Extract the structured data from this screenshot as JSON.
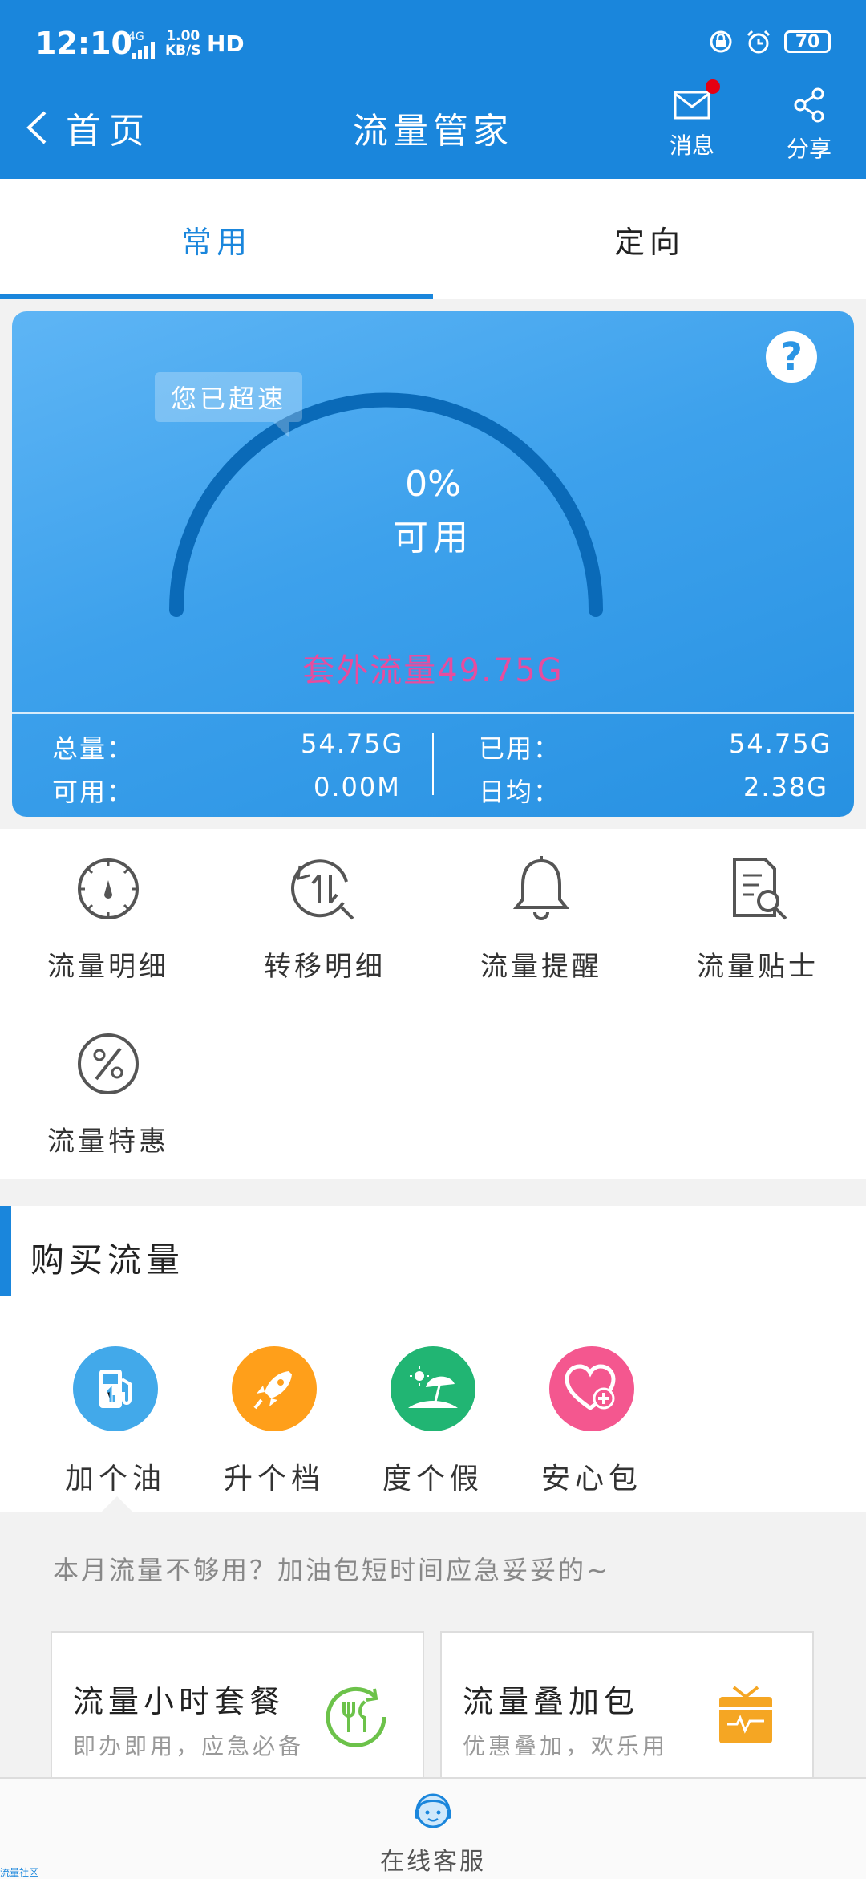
{
  "status_bar": {
    "time": "12:10",
    "network": "4G",
    "speed_value": "1.00",
    "speed_unit": "KB/S",
    "hd": "HD",
    "battery": "70",
    "icons": [
      "lock-rotation-icon",
      "alarm-icon"
    ]
  },
  "header": {
    "back_label": "首页",
    "title": "流量管家",
    "message_label": "消息",
    "share_label": "分享",
    "accent": "#1a86dc",
    "badge_color": "#e60012"
  },
  "tabs": [
    {
      "label": "常用",
      "active": true
    },
    {
      "label": "定向",
      "active": false
    }
  ],
  "usage": {
    "help": "?",
    "bubble": "您已超速",
    "percent": "0%",
    "percent_value": 0,
    "available_label": "可用",
    "overage": "套外流量49.75G",
    "stats": {
      "total_label": "总量：",
      "total_value": "54.75G",
      "available_label": "可用：",
      "available_value": "0.00M",
      "used_label": "已用：",
      "used_value": "54.75G",
      "daily_label": "日均：",
      "daily_value": "2.38G"
    }
  },
  "menu": [
    {
      "label": "流量明细",
      "icon": "dial-icon"
    },
    {
      "label": "转移明细",
      "icon": "transfer-search-icon"
    },
    {
      "label": "流量提醒",
      "icon": "bell-icon"
    },
    {
      "label": "流量贴士",
      "icon": "document-search-icon"
    },
    {
      "label": "流量特惠",
      "icon": "percent-icon"
    }
  ],
  "buy": {
    "title": "购买流量",
    "items": [
      {
        "label": "加个油",
        "icon": "fuel-pump-icon",
        "color": "#42a9ea"
      },
      {
        "label": "升个档",
        "icon": "rocket-icon",
        "color": "#ff9f1a"
      },
      {
        "label": "度个假",
        "icon": "beach-icon",
        "color": "#21b573"
      },
      {
        "label": "安心包",
        "icon": "heart-plus-icon",
        "color": "#f4578f"
      }
    ]
  },
  "tip": "本月流量不够用？加油包短时间应急妥妥的~",
  "packages": [
    {
      "title": "流量小时套餐",
      "subtitle": "即办即用，应急必备",
      "icon": "clock-dining-icon"
    },
    {
      "title": "流量叠加包",
      "subtitle": "优惠叠加，欢乐用",
      "icon": "tv-box-icon"
    }
  ],
  "bottom": {
    "service_label": "在线客服",
    "watermark": "流量社区"
  }
}
